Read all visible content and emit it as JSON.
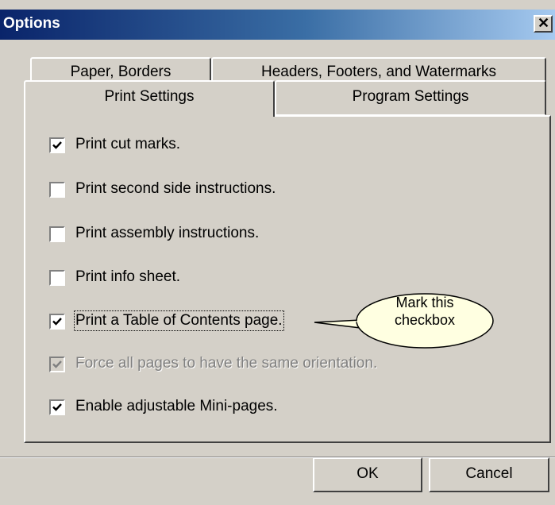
{
  "dialog": {
    "title": "Options",
    "close_glyph": "✕"
  },
  "tabs": {
    "back_row": [
      {
        "label": "Paper, Borders"
      },
      {
        "label": "Headers, Footers, and Watermarks"
      }
    ],
    "front_row": [
      {
        "label": "Print Settings",
        "active": true
      },
      {
        "label": "Program Settings",
        "active": false
      }
    ]
  },
  "checkboxes": [
    {
      "label": "Print cut marks.",
      "checked": true,
      "enabled": true
    },
    {
      "label": "Print second side instructions.",
      "checked": false,
      "enabled": true
    },
    {
      "label": "Print assembly instructions.",
      "checked": false,
      "enabled": true
    },
    {
      "label": "Print info sheet.",
      "checked": false,
      "enabled": true
    },
    {
      "label": "Print a Table of Contents page.",
      "checked": true,
      "enabled": true,
      "focused": true
    },
    {
      "label": "Force all pages to have the same orientation.",
      "checked": true,
      "enabled": false
    },
    {
      "label": "Enable adjustable Mini-pages.",
      "checked": true,
      "enabled": true
    }
  ],
  "callout": {
    "line1": "Mark this",
    "line2": "checkbox",
    "fill_color": "#ffffe1"
  },
  "buttons": {
    "ok": "OK",
    "cancel": "Cancel"
  },
  "colors": {
    "title_start": "#0a246a",
    "title_end": "#a6caf0",
    "face": "#d4d0c8"
  }
}
